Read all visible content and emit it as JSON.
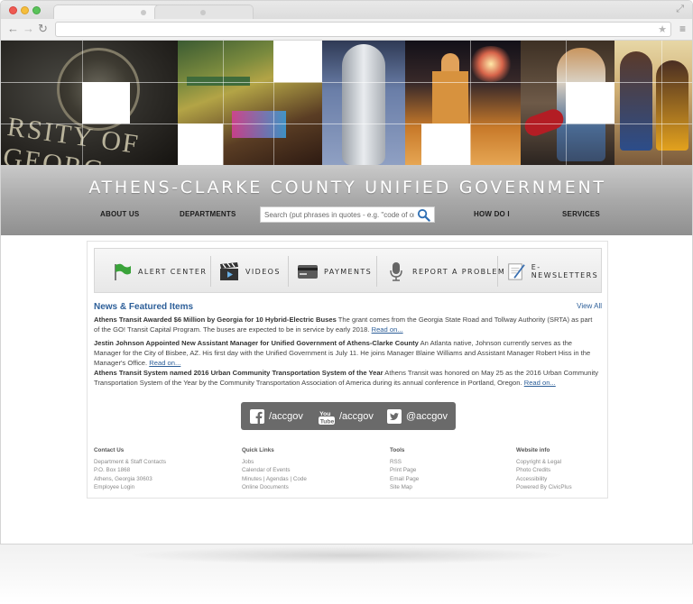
{
  "site": {
    "title": "ATHENS-CLARKE COUNTY UNIFIED GOVERNMENT"
  },
  "nav": {
    "items": [
      "ABOUT US",
      "DEPARTMENTS",
      "HOW DO I",
      "SERVICES"
    ]
  },
  "search": {
    "placeholder": "Search (put phrases in quotes - e.g. \"code of on"
  },
  "quicklinks": [
    {
      "label": "ALERT CENTER",
      "icon": "flag-icon"
    },
    {
      "label": "VIDEOS",
      "icon": "clapperboard-icon"
    },
    {
      "label": "PAYMENTS",
      "icon": "credit-card-icon"
    },
    {
      "label": "REPORT A PROBLEM",
      "icon": "microphone-icon"
    },
    {
      "label": "E-NEWSLETTERS",
      "icon": "newsletter-icon"
    }
  ],
  "news": {
    "heading": "News & Featured Items",
    "view_all": "View All",
    "items": [
      {
        "title": "Athens Transit Awarded $6 Million by Georgia for 10 Hybrid-Electric Buses",
        "body": " The grant comes from the Georgia State Road and Tollway Authority (SRTA) as part of the GO! Transit Capital Program. The buses are expected to be in service by early 2018.",
        "link": "Read on..."
      },
      {
        "title": "Jestin Johnson Appointed New Assistant Manager for Unified Government of Athens-Clarke County",
        "body": " An Atlanta native, Johnson currently serves as the Manager for the City of Bisbee, AZ. His first day with the Unified Government is July 11. He joins Manager Blaine Williams and Assistant Manager Robert Hiss in the Manager's Office.",
        "link": "Read on..."
      },
      {
        "title": "Athens Transit System named 2016 Urban Community Transportation System of the Year",
        "body": " Athens Transit was honored on May 25 as the 2016 Urban Community Transportation System of the Year by the Community Transportation Association of America during its annual conference in Portland, Oregon.",
        "link": "Read on..."
      }
    ]
  },
  "social": [
    {
      "label": "/accgov",
      "icon": "facebook-icon"
    },
    {
      "label": "/accgov",
      "icon": "youtube-icon"
    },
    {
      "label": "@accgov",
      "icon": "twitter-icon"
    }
  ],
  "footer": {
    "contact": {
      "heading": "Contact Us",
      "lines": [
        "Department & Staff Contacts",
        "P.O. Box 1868",
        "Athens, Georgia 30603",
        "Employee Login"
      ]
    },
    "quick_links": {
      "heading": "Quick Links",
      "lines": [
        "Jobs",
        "Calendar of Events",
        "Minutes | Agendas | Code",
        "Online Documents"
      ]
    },
    "tools": {
      "heading": "Tools",
      "lines": [
        "RSS",
        "Print Page",
        "Email Page",
        "Site Map"
      ]
    },
    "website_info": {
      "heading": "Website info",
      "lines": [
        "Copyright & Legal",
        "Photo Credits",
        "Accessibility",
        "Powered By CivicPlus"
      ]
    }
  },
  "colors": {
    "link_blue": "#2d5f99",
    "title_band": "#a9a9a9",
    "social_bar": "#6a6a6a"
  }
}
